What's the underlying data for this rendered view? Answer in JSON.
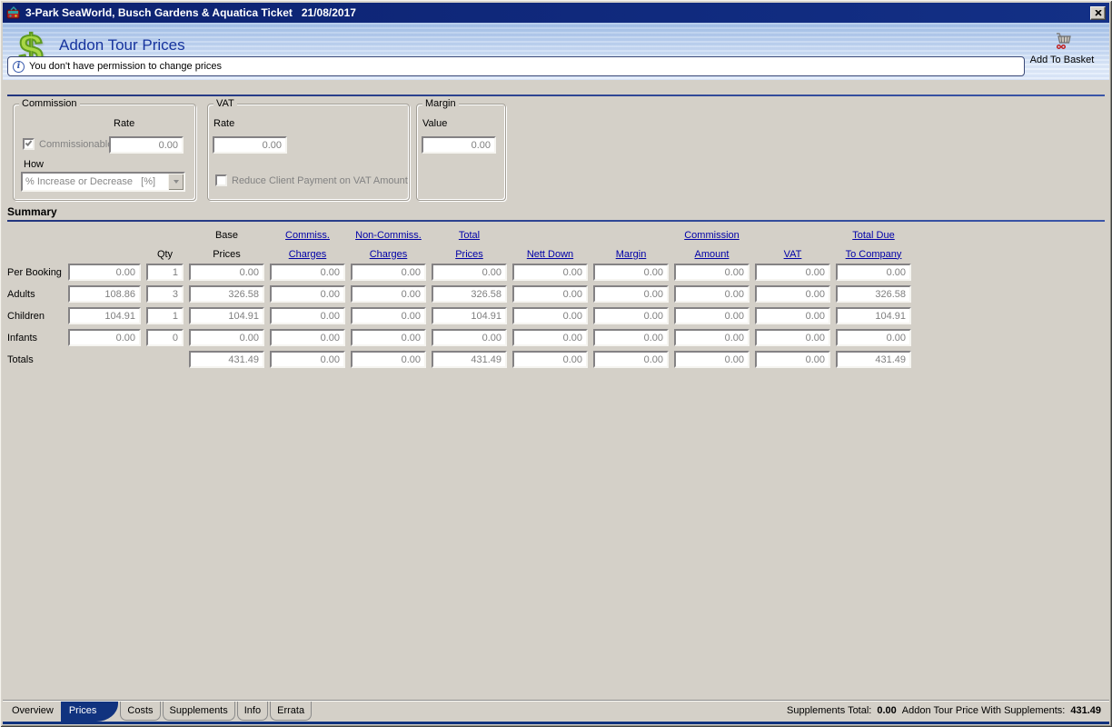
{
  "window": {
    "title": "3-Park SeaWorld, Busch Gardens & Aquatica Ticket   21/08/2017"
  },
  "header": {
    "title": "Addon Tour Prices",
    "dollar_glyph": "$",
    "info_icon_glyph": "i",
    "info_message": "You don't have permission to change prices",
    "add_to_basket": "Add To Basket"
  },
  "panels": {
    "commission": {
      "label": "Commission",
      "rate_label": "Rate",
      "rate_value": "0.00",
      "commissionable_label": "Commissionable",
      "commissionable_checked": true,
      "how_label": "How",
      "how_value": "% Increase or Decrease   [%]"
    },
    "vat": {
      "label": "VAT",
      "rate_label": "Rate",
      "rate_value": "0.00",
      "reduce_label": "Reduce Client Payment on VAT Amount",
      "reduce_checked": false
    },
    "margin": {
      "label": "Margin",
      "value_label": "Value",
      "value": "0.00"
    }
  },
  "summary": {
    "label": "Summary",
    "columns": [
      {
        "key": "price",
        "top": "",
        "bottom": "",
        "link": false
      },
      {
        "key": "qty",
        "top": "",
        "bottom": "Qty",
        "link": false
      },
      {
        "key": "base-prices",
        "top": "Base",
        "bottom": "Prices",
        "link": false
      },
      {
        "key": "commiss-charges",
        "top": "Commiss.",
        "bottom": "Charges",
        "link": true
      },
      {
        "key": "non-commiss-charges",
        "top": "Non-Commiss.",
        "bottom": "Charges",
        "link": true
      },
      {
        "key": "total-prices",
        "top": "Total",
        "bottom": "Prices",
        "link": true
      },
      {
        "key": "nett-down",
        "top": "",
        "bottom": "Nett Down",
        "link": true
      },
      {
        "key": "margin",
        "top": "",
        "bottom": "Margin",
        "link": true
      },
      {
        "key": "commission-amount",
        "top": "Commission",
        "bottom": "Amount",
        "link": true
      },
      {
        "key": "vat",
        "top": "",
        "bottom": "VAT",
        "link": true
      },
      {
        "key": "total-due-to-company",
        "top": "Total Due",
        "bottom": "To Company",
        "link": true
      }
    ],
    "rows": [
      {
        "label": "Per Booking",
        "cells": [
          "0.00",
          "1",
          "0.00",
          "0.00",
          "0.00",
          "0.00",
          "0.00",
          "0.00",
          "0.00",
          "0.00",
          "0.00"
        ]
      },
      {
        "label": "Adults",
        "cells": [
          "108.86",
          "3",
          "326.58",
          "0.00",
          "0.00",
          "326.58",
          "0.00",
          "0.00",
          "0.00",
          "0.00",
          "326.58"
        ]
      },
      {
        "label": "Children",
        "cells": [
          "104.91",
          "1",
          "104.91",
          "0.00",
          "0.00",
          "104.91",
          "0.00",
          "0.00",
          "0.00",
          "0.00",
          "104.91"
        ]
      },
      {
        "label": "Infants",
        "cells": [
          "0.00",
          "0",
          "0.00",
          "0.00",
          "0.00",
          "0.00",
          "0.00",
          "0.00",
          "0.00",
          "0.00",
          "0.00"
        ]
      },
      {
        "label": "Totals",
        "cells": [
          null,
          null,
          "431.49",
          "0.00",
          "0.00",
          "431.49",
          "0.00",
          "0.00",
          "0.00",
          "0.00",
          "431.49"
        ]
      }
    ]
  },
  "tabs": [
    {
      "label": "Overview",
      "selected": false,
      "plain": true
    },
    {
      "label": "Prices",
      "selected": true
    },
    {
      "label": "Costs",
      "selected": false
    },
    {
      "label": "Supplements",
      "selected": false
    },
    {
      "label": "Info",
      "selected": false
    },
    {
      "label": "Errata",
      "selected": false
    }
  ],
  "status": [
    {
      "text": "Supplements Total:",
      "bold": false
    },
    {
      "text": "0.00",
      "bold": true
    },
    {
      "text": "Addon Tour Price With Supplements:",
      "bold": false
    },
    {
      "text": "431.49",
      "bold": true
    }
  ]
}
